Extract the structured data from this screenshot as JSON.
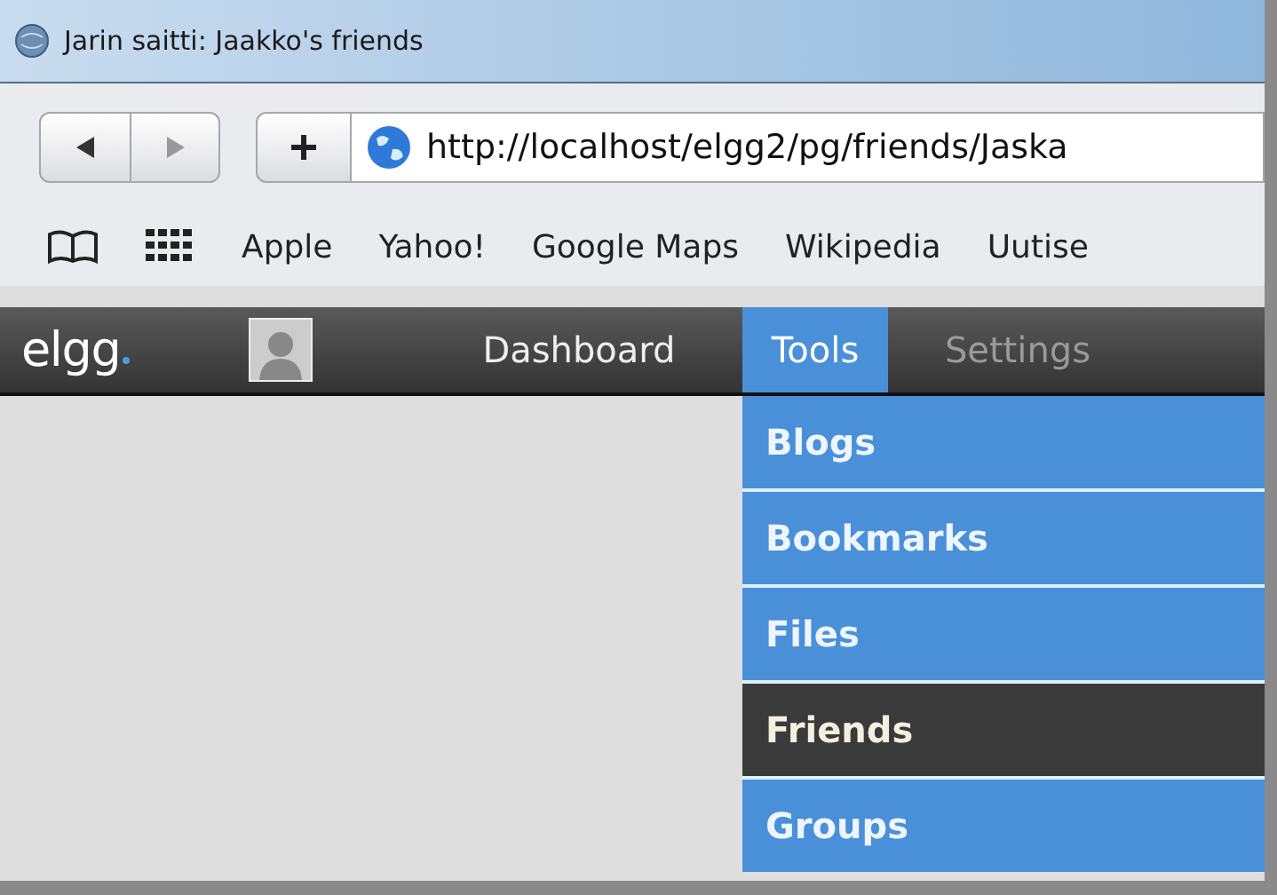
{
  "window": {
    "title": "Jarin saitti: Jaakko's friends"
  },
  "address_bar": {
    "url": "http://localhost/elgg2/pg/friends/Jaska"
  },
  "bookmarks": [
    "Apple",
    "Yahoo!",
    "Google Maps",
    "Wikipedia",
    "Uutise"
  ],
  "site_nav": {
    "logo": "elgg",
    "items": [
      {
        "label": "Dashboard",
        "selected": false
      },
      {
        "label": "Tools",
        "selected": true
      },
      {
        "label": "Settings",
        "selected": false
      }
    ]
  },
  "tools_menu": [
    {
      "label": "Blogs",
      "selected": false
    },
    {
      "label": "Bookmarks",
      "selected": false
    },
    {
      "label": "Files",
      "selected": false
    },
    {
      "label": "Friends",
      "selected": true
    },
    {
      "label": "Groups",
      "selected": false
    }
  ]
}
